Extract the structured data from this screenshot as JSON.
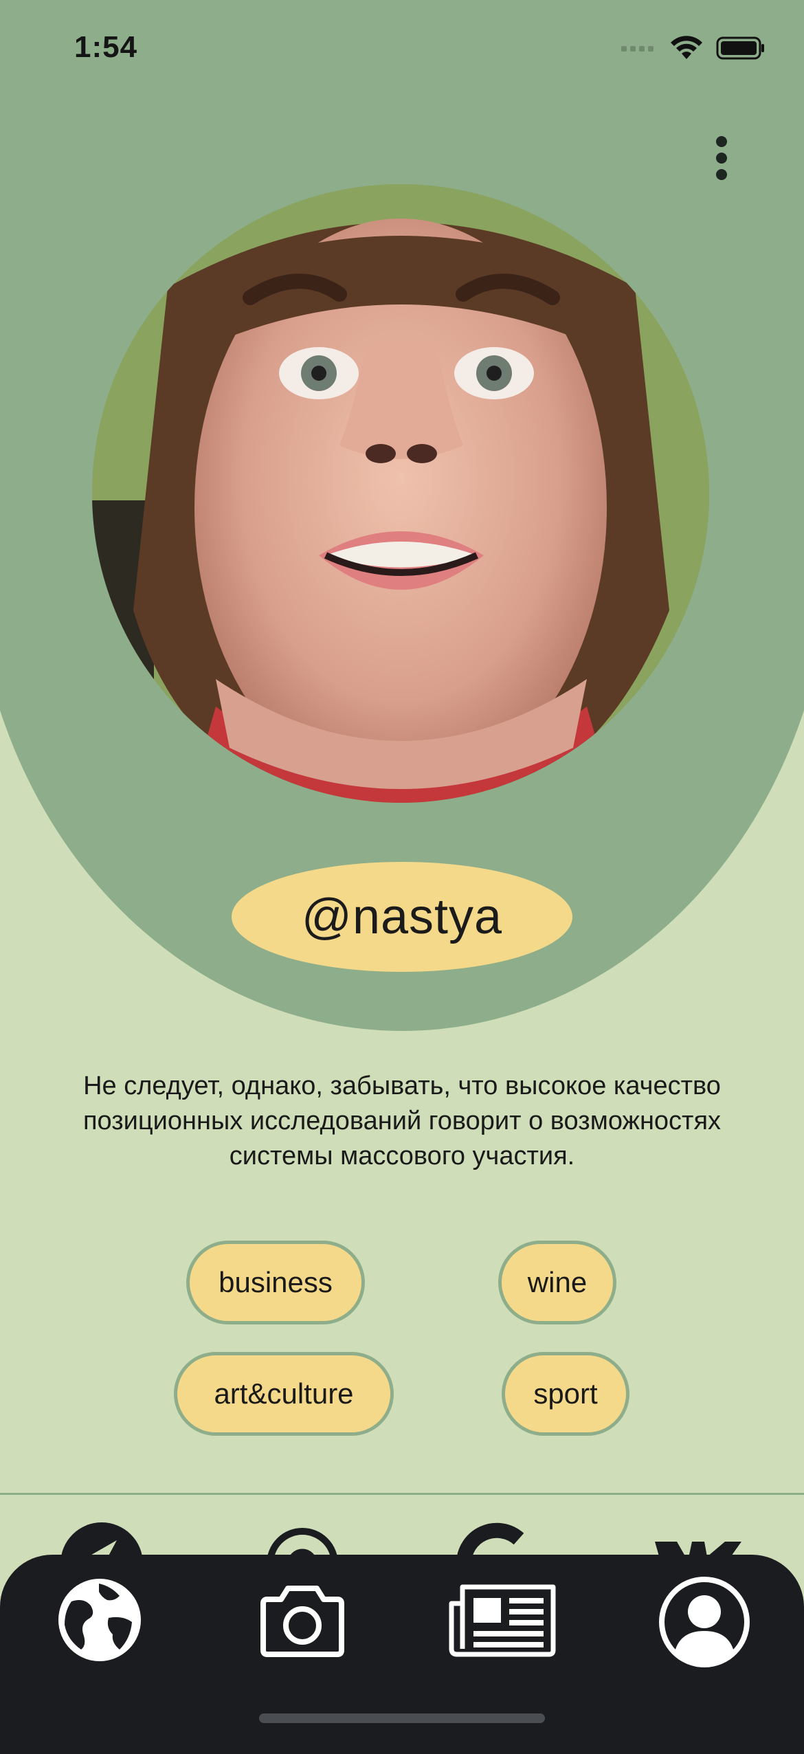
{
  "status_bar": {
    "time": "1:54"
  },
  "profile": {
    "username": "@nastya",
    "bio": "Не следует, однако, забывать, что высокое качество позиционных исследований говорит о возможностях системы массового участия.",
    "tags": [
      "business",
      "wine",
      "art&culture",
      "sport"
    ]
  },
  "tab_bar": {
    "items": [
      "globe-icon",
      "camera-icon",
      "newspaper-icon",
      "profile-icon"
    ]
  },
  "colors": {
    "background": "#cfdeb8",
    "accent_green": "#8eae8b",
    "pill_yellow": "#f5d98a",
    "tab_bar": "#1a1c20"
  }
}
